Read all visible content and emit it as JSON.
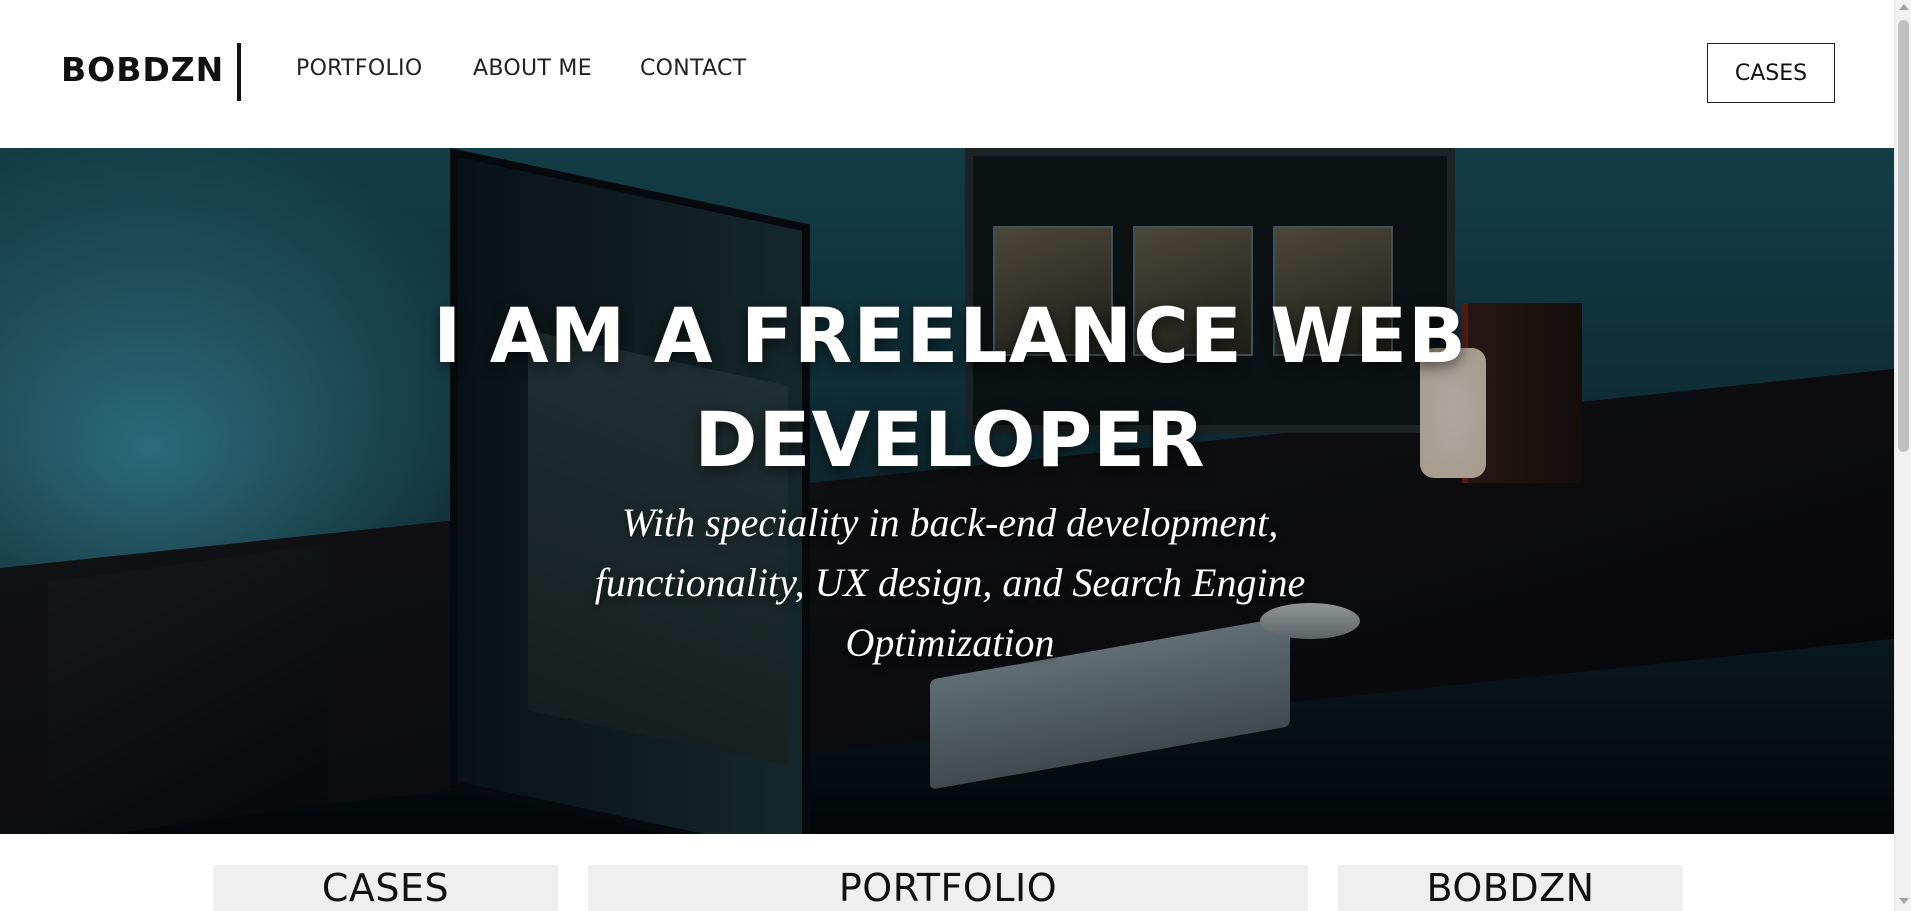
{
  "header": {
    "brand": "BOBDZN",
    "nav": [
      {
        "label": "PORTFOLIO"
      },
      {
        "label": "ABOUT ME"
      },
      {
        "label": "CONTACT"
      }
    ],
    "cta_label": "CASES"
  },
  "hero": {
    "title_line1": "I AM A FREELANCE WEB",
    "title_line2": "DEVELOPER",
    "subtitle": "With speciality in back-end development, functionality, UX design, and Search Engine Optimization"
  },
  "cards": [
    {
      "label": "CASES"
    },
    {
      "label": "PORTFOLIO"
    },
    {
      "label": "BOBDZN"
    }
  ],
  "colors": {
    "text": "#111111",
    "card_bg": "#efefef",
    "hero_overlay": "#1d5a68"
  }
}
